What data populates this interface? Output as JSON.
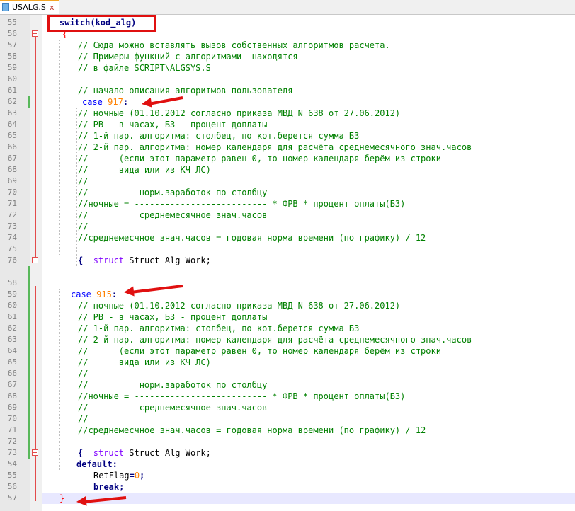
{
  "tab": {
    "filename": "USALG.S",
    "close_glyph": "x"
  },
  "lines": [
    {
      "n": "55",
      "t": "switch(kod_alg)",
      "k": "switch"
    },
    {
      "n": "56",
      "t": "{",
      "k": "brace"
    },
    {
      "n": "57",
      "t": "// Сюда можно вставлять вызов собственных алгоритмов расчета.",
      "k": "cm"
    },
    {
      "n": "58",
      "t": "// Примеры функций с алгоритмами  находятся",
      "k": "cm"
    },
    {
      "n": "59",
      "t": "// в файле SCRIPT\\ALGSYS.S",
      "k": "cm"
    },
    {
      "n": "60",
      "t": "",
      "k": "cm"
    },
    {
      "n": "61",
      "t": "// начало описания алгоритмов пользователя",
      "k": "cm"
    },
    {
      "n": "62",
      "kw": "case",
      "num": "917",
      "k": "case"
    },
    {
      "n": "63",
      "t": "// ночные (01.10.2012 согласно приказа МВД N 638 от 27.06.2012)",
      "k": "cm"
    },
    {
      "n": "64",
      "t": "// РВ - в часах, БЗ - процент доплаты",
      "k": "cm"
    },
    {
      "n": "65",
      "t": "// 1-й пар. алгоритма: столбец, по кот.берется сумма БЗ",
      "k": "cm"
    },
    {
      "n": "66",
      "t": "// 2-й пар. алгоритма: номер календаря для расчёта среднемесячного знач.часов",
      "k": "cm"
    },
    {
      "n": "67",
      "t": "//      (если этот параметр равен 0, то номер календаря берём из строки",
      "k": "cm"
    },
    {
      "n": "68",
      "t": "//      вида или из КЧ ЛС)",
      "k": "cm"
    },
    {
      "n": "69",
      "t": "//",
      "k": "cm"
    },
    {
      "n": "70",
      "t": "//          норм.заработок по столбцу",
      "k": "cm"
    },
    {
      "n": "71",
      "t": "//ночные = -------------------------- * ФРВ * процент оплаты(БЗ)",
      "k": "cm"
    },
    {
      "n": "72",
      "t": "//          среднемесячное знач.часов",
      "k": "cm"
    },
    {
      "n": "73",
      "t": "//",
      "k": "cm"
    },
    {
      "n": "74",
      "t": "//среднемесчное знач.часов = годовая норма времени (по графику) / 12",
      "k": "cm"
    },
    {
      "n": "75",
      "t": "",
      "k": "cm"
    },
    {
      "n": "76",
      "struct": "struct",
      "rest": "Struct Alg Work;",
      "k": "struct"
    },
    {
      "n": "",
      "t": "",
      "k": "cm"
    },
    {
      "n": "58",
      "t": "",
      "k": "cm"
    },
    {
      "n": "59",
      "kw": "case",
      "num": "915",
      "k": "case"
    },
    {
      "n": "60",
      "t": "// ночные (01.10.2012 согласно приказа МВД N 638 от 27.06.2012)",
      "k": "cm"
    },
    {
      "n": "61",
      "t": "// РВ - в часах, БЗ - процент доплаты",
      "k": "cm"
    },
    {
      "n": "62",
      "t": "// 1-й пар. алгоритма: столбец, по кот.берется сумма БЗ",
      "k": "cm"
    },
    {
      "n": "63",
      "t": "// 2-й пар. алгоритма: номер календаря для расчёта среднемесячного знач.часов",
      "k": "cm"
    },
    {
      "n": "64",
      "t": "//      (если этот параметр равен 0, то номер календаря берём из строки",
      "k": "cm"
    },
    {
      "n": "65",
      "t": "//      вида или из КЧ ЛС)",
      "k": "cm"
    },
    {
      "n": "66",
      "t": "//",
      "k": "cm"
    },
    {
      "n": "67",
      "t": "//          норм.заработок по столбцу",
      "k": "cm"
    },
    {
      "n": "68",
      "t": "//ночные = -------------------------- * ФРВ * процент оплаты(БЗ)",
      "k": "cm"
    },
    {
      "n": "69",
      "t": "//          среднемесячное знач.часов",
      "k": "cm"
    },
    {
      "n": "70",
      "t": "//",
      "k": "cm"
    },
    {
      "n": "71",
      "t": "//среднемесчное знач.часов = годовая норма времени (по графику) / 12",
      "k": "cm"
    },
    {
      "n": "72",
      "t": "",
      "k": "cm"
    },
    {
      "n": "73",
      "struct": "struct",
      "rest": "Struct Alg Work;",
      "k": "struct"
    },
    {
      "n": "54",
      "kwb": "default:",
      "k": "default"
    },
    {
      "n": "55",
      "var": "RetFlag",
      "num": "0",
      "k": "assign"
    },
    {
      "n": "56",
      "kwb": "break;",
      "k": "break"
    },
    {
      "n": "57",
      "t": "}",
      "k": "brace"
    }
  ]
}
